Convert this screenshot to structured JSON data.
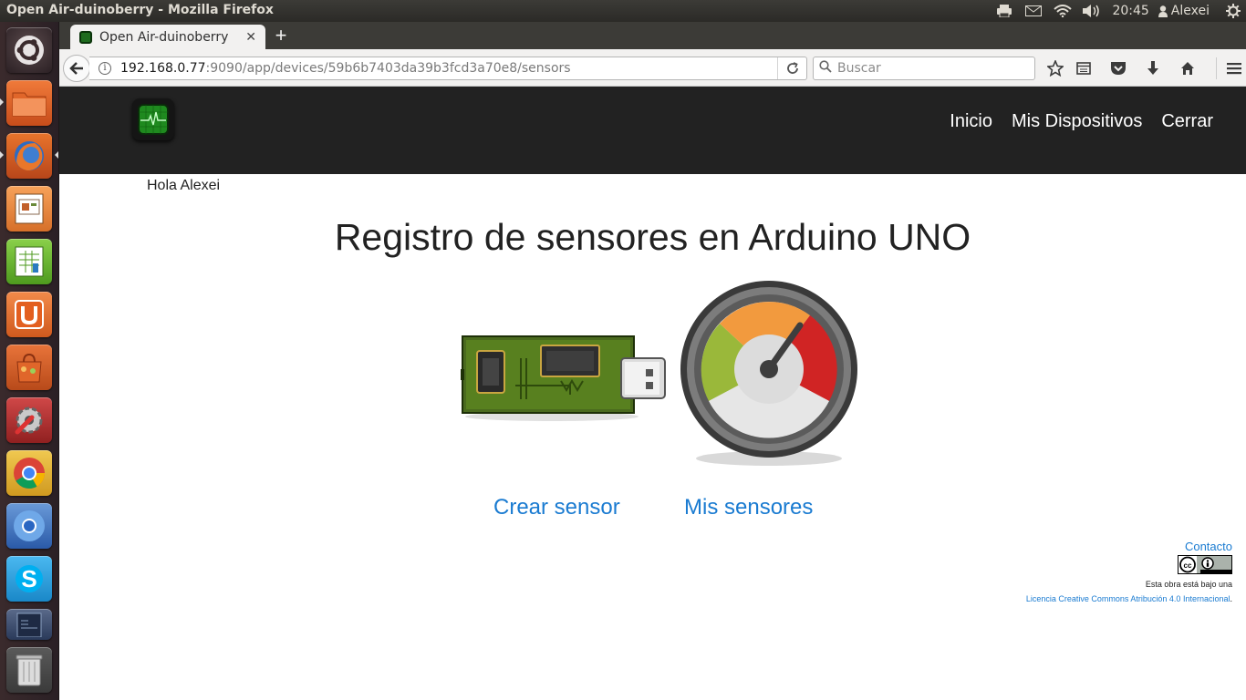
{
  "os_panel": {
    "window_title": "Open Air-duinoberry - Mozilla Firefox",
    "clock": "20:45",
    "user": "Alexei",
    "icons": [
      "printer-icon",
      "mail-icon",
      "wifi-icon",
      "volume-icon",
      "user-icon",
      "settings-gear-icon"
    ]
  },
  "launcher": {
    "items": [
      "ubuntu-dash",
      "files",
      "firefox",
      "libreoffice-impress",
      "libreoffice-calc",
      "ubuntu-one",
      "software-center",
      "system-settings",
      "chrome",
      "chromium",
      "skype",
      "libreoffice-writer",
      "trash"
    ]
  },
  "browser": {
    "tab_title": "Open Air-duinoberry",
    "url_host": "192.168.0.77",
    "url_path": ":9090/app/devices/59b6b7403da39b3fcd3a70e8/sensors",
    "search_placeholder": "Buscar"
  },
  "site": {
    "nav": {
      "inicio": "Inicio",
      "mis_dispositivos": "Mis Dispositivos",
      "cerrar": "Cerrar"
    },
    "greeting": "Hola Alexei",
    "title": "Registro de sensores en Arduino UNO",
    "crear_sensor": "Crear sensor",
    "mis_sensores": "Mis sensores",
    "footer": {
      "contacto": "Contacto",
      "license_text": "Esta obra está bajo una",
      "license_link": "Licencia Creative Commons Atribución 4.0 Internacional",
      "license_end": "."
    }
  },
  "colors": {
    "link": "#1a7bd1",
    "header_bg": "#222222",
    "panel_bg": "#3c3b37"
  }
}
